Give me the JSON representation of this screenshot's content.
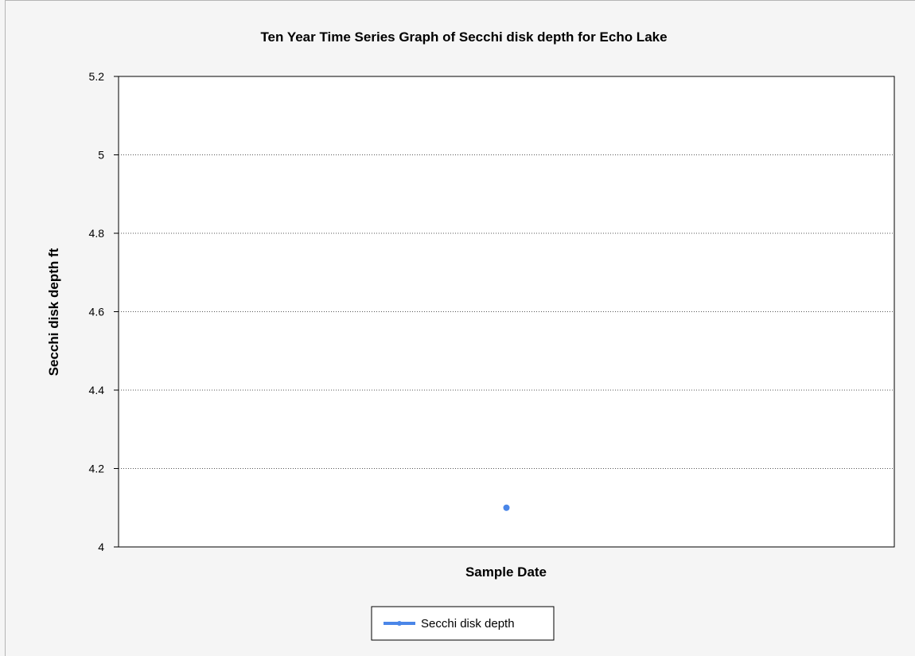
{
  "chart_data": {
    "type": "line",
    "title": "Ten Year Time Series Graph of Secchi disk depth for Echo Lake",
    "xlabel": "Sample Date",
    "ylabel": "Secchi disk depth ft",
    "ylim": [
      4,
      5.2
    ],
    "yticks": [
      "4",
      "4.2",
      "4.4",
      "4.6",
      "4.8",
      "5",
      "5.2"
    ],
    "grid": true,
    "legend_position": "bottom-center",
    "series": [
      {
        "name": "Secchi disk depth",
        "color": "#4a86e8",
        "values": [
          4.1
        ]
      }
    ]
  }
}
